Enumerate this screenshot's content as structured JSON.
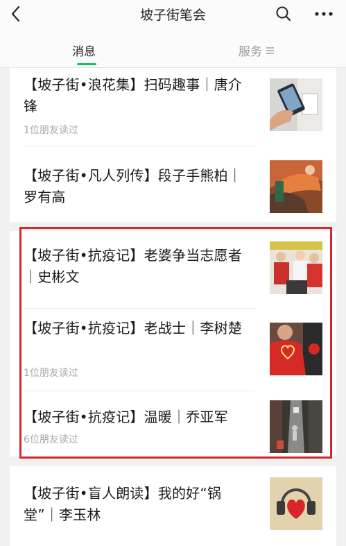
{
  "nav": {
    "title": "坡子街笔会",
    "back_icon": "chevron-left-icon",
    "search_icon": "search-icon",
    "more_icon": "more-dots-icon"
  },
  "tabs": {
    "messages": "消息",
    "service": "服务",
    "accent": "#15c25e"
  },
  "articles": [
    {
      "title": "【坡子街•浪花集】扫码趣事｜唐介锋",
      "reads": "1位朋友读过"
    },
    {
      "title": "【坡子街•凡人列传】段子手熊柏｜罗有高",
      "reads": ""
    },
    {
      "title": "【坡子街•抗疫记】老婆争当志愿者｜史彬文",
      "reads": ""
    },
    {
      "title": "【坡子街•抗疫记】老战士｜李树楚",
      "reads": "1位朋友读过"
    },
    {
      "title": "【坡子街•抗疫记】温暖｜乔亚军",
      "reads": "6位朋友读过"
    },
    {
      "title": "【坡子街•盲人朗读】我的好“锅堂”｜李玉林",
      "reads": ""
    }
  ],
  "highlight_color": "#d9242b"
}
